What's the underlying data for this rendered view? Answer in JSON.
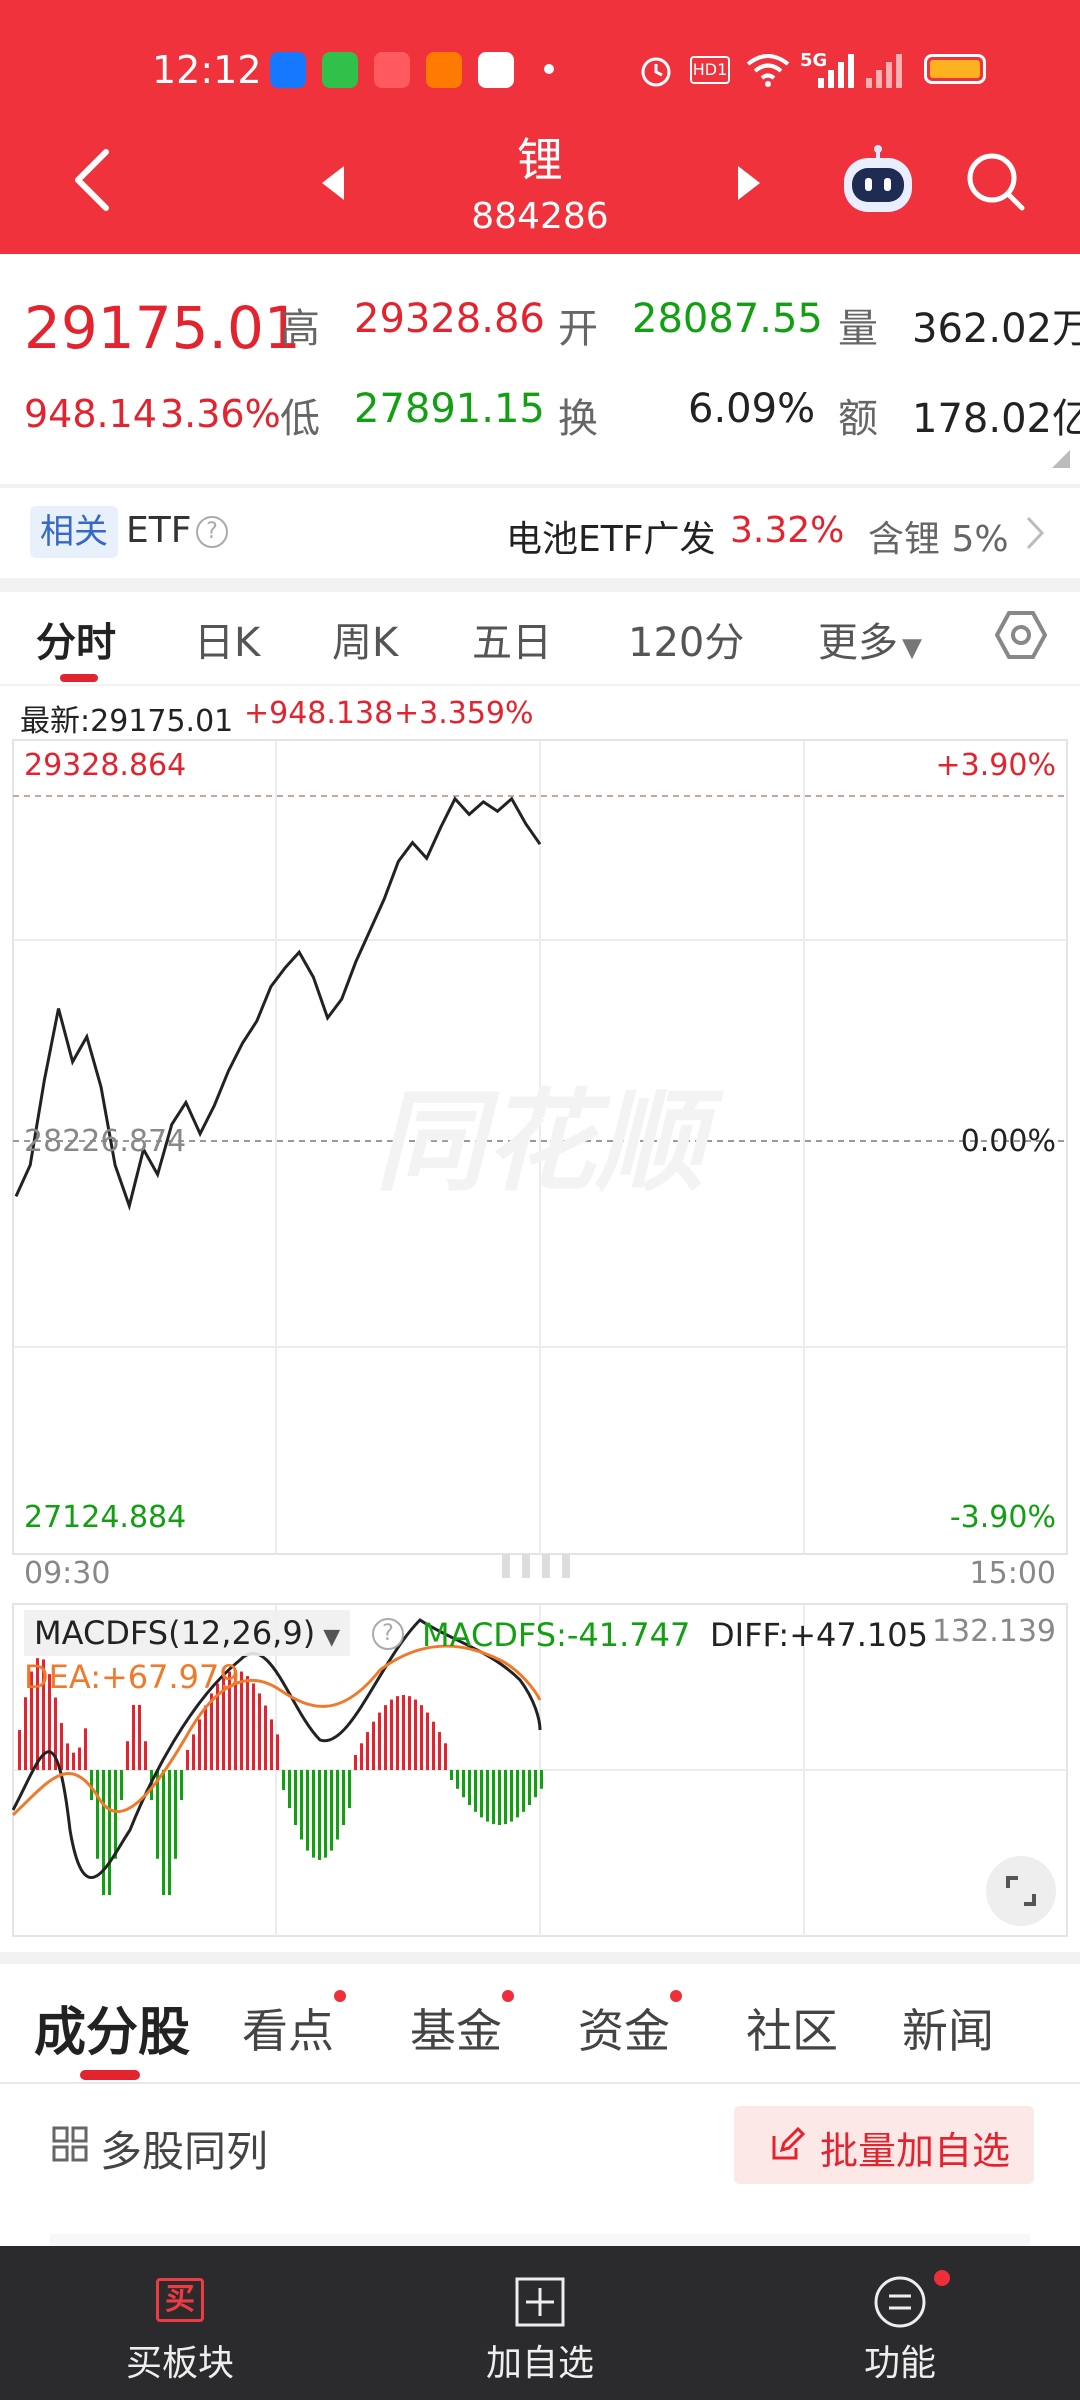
{
  "status_bar": {
    "time": "12:12",
    "network": "5G",
    "hd_label": "HD1",
    "app_icons": [
      "alipay-icon",
      "wechat-app-icon",
      "video-app-icon",
      "shop-1688-icon",
      "home-app-icon"
    ]
  },
  "nav": {
    "title": "锂",
    "code": "884286"
  },
  "quote": {
    "price": "29175.01",
    "change": "948.14",
    "change_pct": "3.36%",
    "high_label": "高",
    "high": "29328.86",
    "low_label": "低",
    "low": "27891.15",
    "open_label": "开",
    "open": "28087.55",
    "turnover_label": "换",
    "turnover": "6.09%",
    "volume_label": "量",
    "volume": "362.02万",
    "amount_label": "额",
    "amount": "178.02亿"
  },
  "etf": {
    "tag": "相关",
    "label": "ETF",
    "name": "电池ETF广发",
    "pct": "3.32%",
    "contains": "含锂 5%"
  },
  "period_tabs": [
    "分时",
    "日K",
    "周K",
    "五日",
    "120分",
    "更多"
  ],
  "intraday": {
    "latest_label": "最新:29175.01",
    "change": "+948.138",
    "change_pct": "+3.359%",
    "top_price": "29328.864",
    "top_pct": "+3.90%",
    "mid_price": "28226.874",
    "mid_pct": "0.00%",
    "bottom_price": "27124.884",
    "bottom_pct": "-3.90%",
    "time_start": "09:30",
    "time_end": "15:00",
    "watermark": "同花顺"
  },
  "macd": {
    "label": "MACDFS(12,26,9)",
    "macdfs": "MACDFS:-41.747",
    "diff": "DIFF:+47.105",
    "dea": "DEA:+67.979",
    "max": "132.139"
  },
  "chart_data": {
    "type": "line",
    "x_range": [
      "09:30",
      "15:00"
    ],
    "ylim": [
      27124.884,
      29328.864
    ],
    "y_ref": 28226.874,
    "price": [
      28050,
      28150,
      28420,
      28650,
      28480,
      28560,
      28400,
      28150,
      28020,
      28200,
      28120,
      28280,
      28350,
      28250,
      28340,
      28450,
      28540,
      28610,
      28720,
      28780,
      28830,
      28750,
      28620,
      28680,
      28800,
      28900,
      29000,
      29120,
      29180,
      29130,
      29230,
      29320,
      29270,
      29310,
      29280,
      29320,
      29240,
      29175
    ]
  },
  "info_tabs": [
    "成分股",
    "看点",
    "基金",
    "资金",
    "社区",
    "新闻"
  ],
  "list_tools": {
    "multi": "多股同列",
    "batch_add": "批量加自选"
  },
  "bottom_bar": {
    "buy_icon_char": "买",
    "buy_label": "买板块",
    "add_label": "加自选",
    "func_label": "功能"
  }
}
